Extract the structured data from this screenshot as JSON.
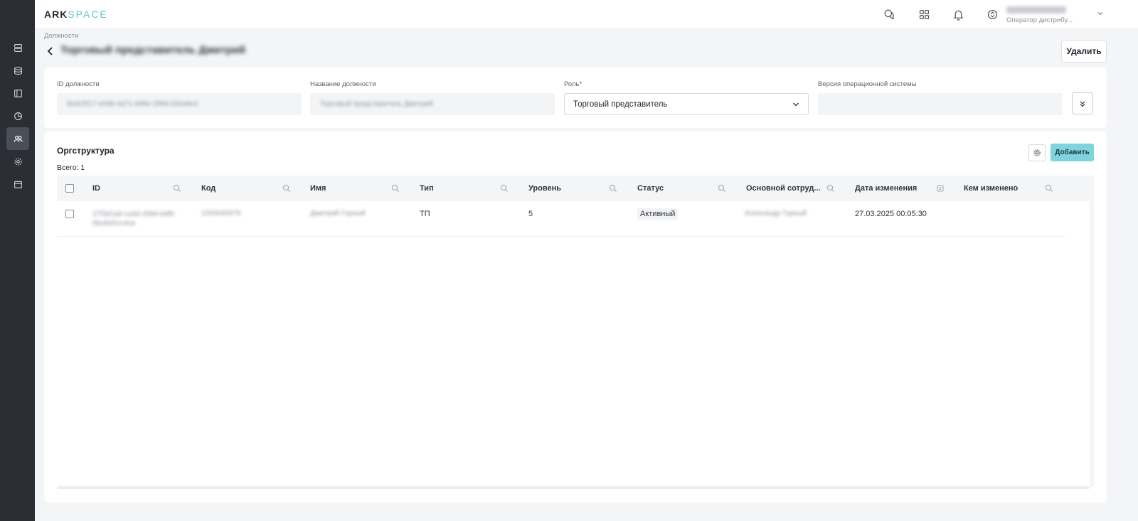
{
  "app": {
    "logo_main": "ARK",
    "logo_sub": "SPACE"
  },
  "user": {
    "role": "Оператор дистрибу..."
  },
  "breadcrumb": "Должности",
  "page": {
    "delete_label": "Удалить"
  },
  "form": {
    "id_label": "ID должности",
    "name_label": "Название должности",
    "role_label": "Роль*",
    "role_value": "Торговый представитель",
    "os_label": "Версия операционной системы"
  },
  "org": {
    "title": "Оргструктура",
    "total": "Всего: 1",
    "add_label": "Добавить",
    "columns": [
      "ID",
      "Код",
      "Имя",
      "Тип",
      "Уровень",
      "Статус",
      "Основной сотруд...",
      "Дата изменения",
      "Кем изменено"
    ],
    "rows": [
      {
        "type": "ТП",
        "level": "5",
        "status": "Активный",
        "modified": "27.03.2025 00:05:30"
      }
    ]
  },
  "icons": {
    "sidebar": [
      "server-icon",
      "database-icon",
      "layout-icon",
      "pie-chart-icon",
      "users-icon",
      "settings-icon",
      "calendar-icon"
    ],
    "topbar": [
      "chat-icon",
      "apps-grid-icon",
      "bell-icon",
      "sync-icon"
    ]
  },
  "colors": {
    "sidebar_bg": "#2b2e34",
    "accent": "#63c7cf",
    "add_button": "#7fd3dc"
  }
}
